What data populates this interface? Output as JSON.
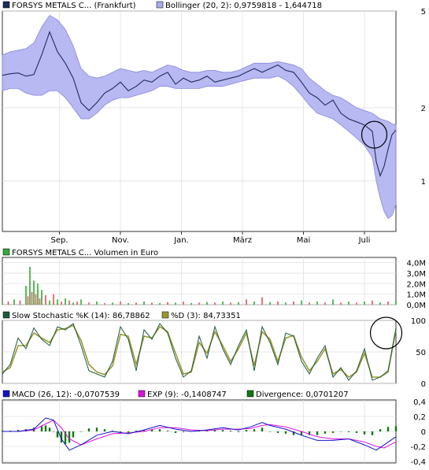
{
  "chart_data": [
    {
      "type": "line",
      "panel": "price",
      "legend": [
        {
          "label": "FORSYS METALS C... (Frankfurt)",
          "color": "#1f2d5a",
          "kind": "line"
        },
        {
          "label": "Bollinger (20, 2): 0,9759818 - 1,644718",
          "color": "#aaaaee",
          "kind": "band"
        }
      ],
      "ylog": true,
      "ylim": [
        0.62,
        5.0
      ],
      "yticks": [
        {
          "v": 5,
          "label": "5"
        },
        {
          "v": 2,
          "label": "2"
        },
        {
          "v": 1,
          "label": "1"
        }
      ],
      "xrange": [
        0,
        100
      ],
      "xticks": [
        {
          "x": 14.5,
          "label": "Sep."
        },
        {
          "x": 30.0,
          "label": "Nov."
        },
        {
          "x": 45.5,
          "label": "Jan."
        },
        {
          "x": 61.0,
          "label": "März"
        },
        {
          "x": 76.5,
          "label": "Mai"
        },
        {
          "x": 92.0,
          "label": "Juli"
        }
      ],
      "grid": true,
      "series": [
        {
          "name": "FORSYS METALS C... (Frankfurt)",
          "x": [
            0,
            2,
            4,
            6,
            8,
            10,
            12,
            14,
            16,
            18,
            20,
            22,
            24,
            26,
            28,
            30,
            32,
            34,
            36,
            38,
            40,
            42,
            44,
            46,
            48,
            50,
            52,
            54,
            56,
            58,
            60,
            62,
            64,
            66,
            68,
            70,
            72,
            74,
            76,
            78,
            80,
            82,
            84,
            86,
            88,
            90,
            92,
            94,
            95,
            96,
            97,
            98,
            99,
            100
          ],
          "values": [
            2.72,
            2.76,
            2.78,
            2.7,
            2.74,
            3.3,
            4.1,
            3.4,
            3.05,
            2.65,
            2.1,
            1.95,
            2.1,
            2.3,
            2.4,
            2.55,
            2.35,
            2.45,
            2.6,
            2.55,
            2.7,
            2.8,
            2.5,
            2.65,
            2.55,
            2.6,
            2.7,
            2.55,
            2.6,
            2.65,
            2.7,
            2.8,
            2.9,
            2.8,
            2.9,
            3.0,
            2.85,
            2.8,
            2.55,
            2.3,
            2.2,
            2.05,
            2.15,
            1.9,
            1.8,
            1.75,
            1.7,
            1.6,
            1.2,
            1.05,
            1.15,
            1.35,
            1.55,
            1.62
          ]
        }
      ],
      "band": {
        "upper": [
          3.3,
          3.4,
          3.45,
          3.5,
          3.7,
          4.3,
          4.8,
          4.6,
          4.2,
          3.6,
          2.9,
          2.7,
          2.65,
          2.7,
          2.8,
          2.9,
          2.85,
          2.8,
          2.85,
          2.8,
          2.9,
          3.0,
          2.95,
          2.85,
          2.8,
          2.8,
          2.85,
          2.85,
          2.8,
          2.8,
          2.85,
          2.95,
          3.05,
          3.05,
          3.05,
          3.1,
          3.05,
          3.0,
          2.9,
          2.65,
          2.5,
          2.35,
          2.25,
          2.2,
          2.1,
          2.0,
          1.95,
          1.9,
          1.85,
          1.8,
          1.78,
          1.76,
          1.72,
          1.7
        ],
        "lower": [
          2.35,
          2.4,
          2.4,
          2.3,
          2.25,
          2.25,
          2.35,
          2.35,
          2.2,
          2.0,
          1.8,
          1.8,
          1.9,
          2.05,
          2.15,
          2.2,
          2.2,
          2.25,
          2.3,
          2.35,
          2.45,
          2.45,
          2.4,
          2.4,
          2.4,
          2.4,
          2.45,
          2.45,
          2.45,
          2.5,
          2.55,
          2.6,
          2.65,
          2.65,
          2.65,
          2.7,
          2.6,
          2.45,
          2.25,
          2.05,
          1.9,
          1.85,
          1.8,
          1.7,
          1.6,
          1.5,
          1.4,
          1.25,
          1.0,
          0.85,
          0.75,
          0.7,
          0.72,
          0.8
        ]
      },
      "annotation": {
        "shape": "circle",
        "x": 94.5,
        "y": 1.55
      }
    },
    {
      "type": "bar",
      "panel": "volume",
      "legend": [
        {
          "label": "FORSYS METALS C... Volumen in Euro",
          "color": "#33aa33",
          "kind": "bar"
        }
      ],
      "ylim": [
        0,
        4.5
      ],
      "yticks": [
        {
          "v": 4,
          "label": "4,0M"
        },
        {
          "v": 3,
          "label": "3,0M"
        },
        {
          "v": 2,
          "label": "2,0M"
        },
        {
          "v": 1,
          "label": "1,0M"
        },
        {
          "v": 0,
          "label": "0,0M"
        }
      ],
      "x": [
        0,
        1.5,
        3,
        4.5,
        6,
        6.5,
        7,
        7.5,
        8,
        8.5,
        9,
        9.5,
        10,
        11,
        12,
        13,
        14,
        15,
        16,
        17,
        18,
        19,
        20,
        22,
        24,
        26,
        28,
        30,
        32,
        34,
        36,
        38,
        40,
        42,
        44,
        46,
        48,
        50,
        52,
        54,
        56,
        58,
        60,
        62,
        64,
        66,
        68,
        70,
        72,
        74,
        76,
        78,
        80,
        82,
        84,
        86,
        88,
        90,
        92,
        94,
        96,
        98,
        100
      ],
      "values": [
        0.12,
        0.3,
        0.5,
        0.4,
        1.8,
        0.8,
        3.6,
        1.2,
        2.3,
        1.0,
        2.0,
        0.6,
        1.4,
        0.9,
        0.4,
        1.0,
        0.5,
        0.3,
        0.6,
        0.4,
        0.2,
        0.3,
        0.5,
        0.2,
        0.3,
        0.15,
        0.2,
        0.3,
        0.15,
        0.2,
        0.3,
        0.2,
        0.15,
        0.25,
        0.2,
        0.3,
        0.15,
        0.2,
        0.25,
        0.2,
        0.3,
        0.2,
        0.25,
        0.5,
        0.3,
        0.7,
        0.25,
        0.3,
        0.2,
        0.3,
        0.4,
        0.2,
        0.3,
        0.2,
        0.5,
        0.2,
        0.3,
        0.2,
        0.3,
        0.4,
        0.2,
        0.3,
        0.35
      ],
      "colors": [
        "#33aa33",
        "#dd5555"
      ]
    },
    {
      "type": "line",
      "panel": "stochastic",
      "legend": [
        {
          "label": "Slow Stochastic %K (14): 86,78862",
          "color": "#1f5a3a",
          "kind": "line"
        },
        {
          "label": "%D (3): 84,73351",
          "color": "#999933",
          "kind": "line"
        }
      ],
      "ylim": [
        0,
        100
      ],
      "yticks": [
        {
          "v": 100,
          "label": "100"
        },
        {
          "v": 50,
          "label": "50"
        },
        {
          "v": 0,
          "label": "0"
        }
      ],
      "series": [
        {
          "name": "Slow Stochastic %K (14): 86,78862",
          "x": [
            0,
            2,
            4,
            6,
            8,
            10,
            12,
            14,
            16,
            18,
            20,
            22,
            24,
            26,
            28,
            30,
            32,
            34,
            36,
            38,
            40,
            42,
            44,
            46,
            48,
            50,
            52,
            54,
            56,
            58,
            60,
            62,
            64,
            66,
            68,
            70,
            72,
            74,
            76,
            78,
            80,
            82,
            84,
            86,
            88,
            90,
            92,
            94,
            96,
            98,
            100
          ],
          "values": [
            15,
            30,
            72,
            55,
            88,
            70,
            60,
            90,
            85,
            95,
            60,
            20,
            15,
            10,
            35,
            90,
            70,
            20,
            85,
            70,
            95,
            80,
            40,
            10,
            20,
            75,
            40,
            90,
            55,
            30,
            60,
            85,
            20,
            90,
            65,
            30,
            80,
            75,
            35,
            15,
            40,
            60,
            10,
            25,
            5,
            20,
            55,
            5,
            10,
            20,
            88
          ]
        },
        {
          "name": "%D (3): 84,73351",
          "x": [
            0,
            2,
            4,
            6,
            8,
            10,
            12,
            14,
            16,
            18,
            20,
            22,
            24,
            26,
            28,
            30,
            32,
            34,
            36,
            38,
            40,
            42,
            44,
            46,
            48,
            50,
            52,
            54,
            56,
            58,
            60,
            62,
            64,
            66,
            68,
            70,
            72,
            74,
            76,
            78,
            80,
            82,
            84,
            86,
            88,
            90,
            92,
            94,
            96,
            98,
            100
          ],
          "values": [
            18,
            25,
            60,
            60,
            80,
            72,
            65,
            85,
            87,
            92,
            68,
            30,
            18,
            14,
            28,
            78,
            75,
            30,
            75,
            72,
            90,
            82,
            48,
            15,
            18,
            65,
            48,
            82,
            60,
            35,
            55,
            80,
            28,
            82,
            70,
            35,
            72,
            76,
            42,
            20,
            35,
            55,
            15,
            22,
            10,
            18,
            48,
            10,
            10,
            18,
            85
          ]
        }
      ],
      "annotation": {
        "shape": "circle",
        "x": 97.5,
        "y": 80
      }
    },
    {
      "type": "line",
      "panel": "macd",
      "legend": [
        {
          "label": "MACD (26, 12): -0,0707539",
          "color": "#1111cc",
          "kind": "line"
        },
        {
          "label": "EXP (9): -0,1408747",
          "color": "#dd11dd",
          "kind": "line"
        },
        {
          "label": "Divergence: 0,0701207",
          "color": "#117711",
          "kind": "bar"
        }
      ],
      "ylim": [
        -0.42,
        0.42
      ],
      "yticks": [
        {
          "v": 0.4,
          "label": "0,4"
        },
        {
          "v": 0.2,
          "label": "0,2"
        },
        {
          "v": 0,
          "label": "0"
        },
        {
          "v": -0.2,
          "label": "-0,2"
        },
        {
          "v": -0.4,
          "label": "-0,4"
        }
      ],
      "series": [
        {
          "name": "MACD (26, 12): -0,0707539",
          "x": [
            0,
            4,
            8,
            11,
            13,
            15,
            17,
            20,
            24,
            28,
            32,
            36,
            40,
            44,
            48,
            52,
            56,
            60,
            63,
            66,
            68,
            72,
            76,
            80,
            84,
            88,
            92,
            95,
            97,
            100
          ],
          "values": [
            0,
            0,
            0.03,
            0.18,
            0.15,
            -0.1,
            -0.25,
            -0.18,
            -0.05,
            0.0,
            -0.03,
            0.02,
            0.08,
            0.03,
            0.0,
            0.02,
            0.05,
            0.02,
            0.06,
            0.12,
            0.08,
            0.03,
            -0.05,
            -0.12,
            -0.12,
            -0.1,
            -0.18,
            -0.25,
            -0.18,
            -0.07
          ]
        },
        {
          "name": "EXP (9): -0,1408747",
          "x": [
            0,
            4,
            8,
            11,
            13,
            15,
            17,
            20,
            24,
            28,
            32,
            36,
            40,
            44,
            48,
            52,
            56,
            60,
            63,
            66,
            68,
            72,
            76,
            80,
            84,
            88,
            92,
            95,
            97,
            100
          ],
          "values": [
            0,
            0,
            0.02,
            0.1,
            0.15,
            0.05,
            -0.1,
            -0.18,
            -0.1,
            -0.03,
            -0.02,
            0.0,
            0.05,
            0.05,
            0.02,
            0.01,
            0.03,
            0.03,
            0.04,
            0.08,
            0.09,
            0.06,
            0.0,
            -0.07,
            -0.1,
            -0.1,
            -0.14,
            -0.2,
            -0.22,
            -0.14
          ]
        }
      ],
      "divergence": {
        "x": [
          0,
          2,
          4,
          6,
          8,
          10,
          11,
          12,
          13,
          14,
          15,
          16,
          17,
          18,
          20,
          22,
          24,
          26,
          28,
          30,
          32,
          34,
          36,
          38,
          40,
          42,
          44,
          46,
          48,
          50,
          52,
          54,
          56,
          58,
          60,
          62,
          64,
          66,
          68,
          70,
          72,
          74,
          76,
          78,
          80,
          82,
          84,
          86,
          88,
          90,
          92,
          94,
          96,
          98,
          100
        ],
        "values": [
          0.01,
          0.01,
          0.02,
          0.03,
          0.05,
          0.07,
          0.08,
          0.05,
          0.0,
          -0.08,
          -0.15,
          -0.17,
          -0.15,
          -0.08,
          0.0,
          0.04,
          0.05,
          0.03,
          0.01,
          -0.01,
          -0.02,
          0.01,
          0.02,
          0.03,
          0.03,
          0.01,
          -0.02,
          -0.01,
          0.0,
          0.01,
          0.01,
          0.02,
          0.02,
          0.01,
          -0.01,
          0.02,
          0.03,
          0.05,
          0.0,
          -0.02,
          -0.03,
          -0.05,
          -0.05,
          -0.05,
          -0.05,
          -0.03,
          -0.02,
          0.0,
          -0.01,
          -0.02,
          -0.04,
          -0.05,
          0.03,
          0.06,
          0.07
        ]
      }
    }
  ]
}
